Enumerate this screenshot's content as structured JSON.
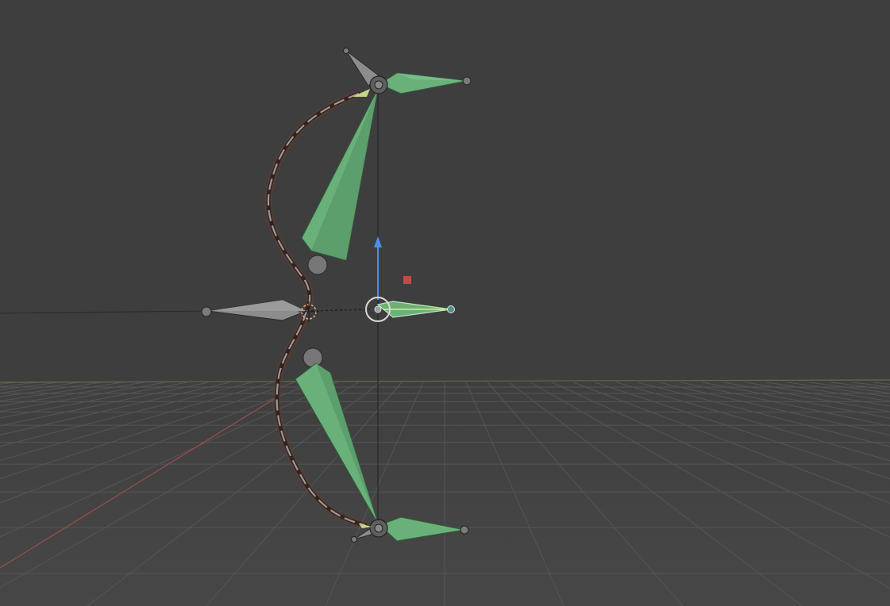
{
  "viewport": {
    "background": "#3e3e3e",
    "grid_color": "#555555",
    "horizon_color": "#5f6e4f",
    "x_axis_color": "#9c4c4c"
  },
  "armature": {
    "bone_fill": "#6ab07a",
    "bone_fill_dark": "#4f8c5e",
    "bone_edge": "#2f5a36",
    "joint_color": "#7a7a7a",
    "gray_bone_fill": "#8d8d8d",
    "string_color": "#3a2a22",
    "string_glow": "#6b3a2a"
  },
  "gizmo": {
    "up_arrow_color": "#4a8ef0",
    "object_origin_color": "#d9d9d9",
    "point_color": "#c44a4a",
    "cursor_color": "#e8a08a"
  },
  "icons": [
    "transform-gizmo-icon",
    "3d-cursor-icon",
    "origin-point-icon"
  ]
}
